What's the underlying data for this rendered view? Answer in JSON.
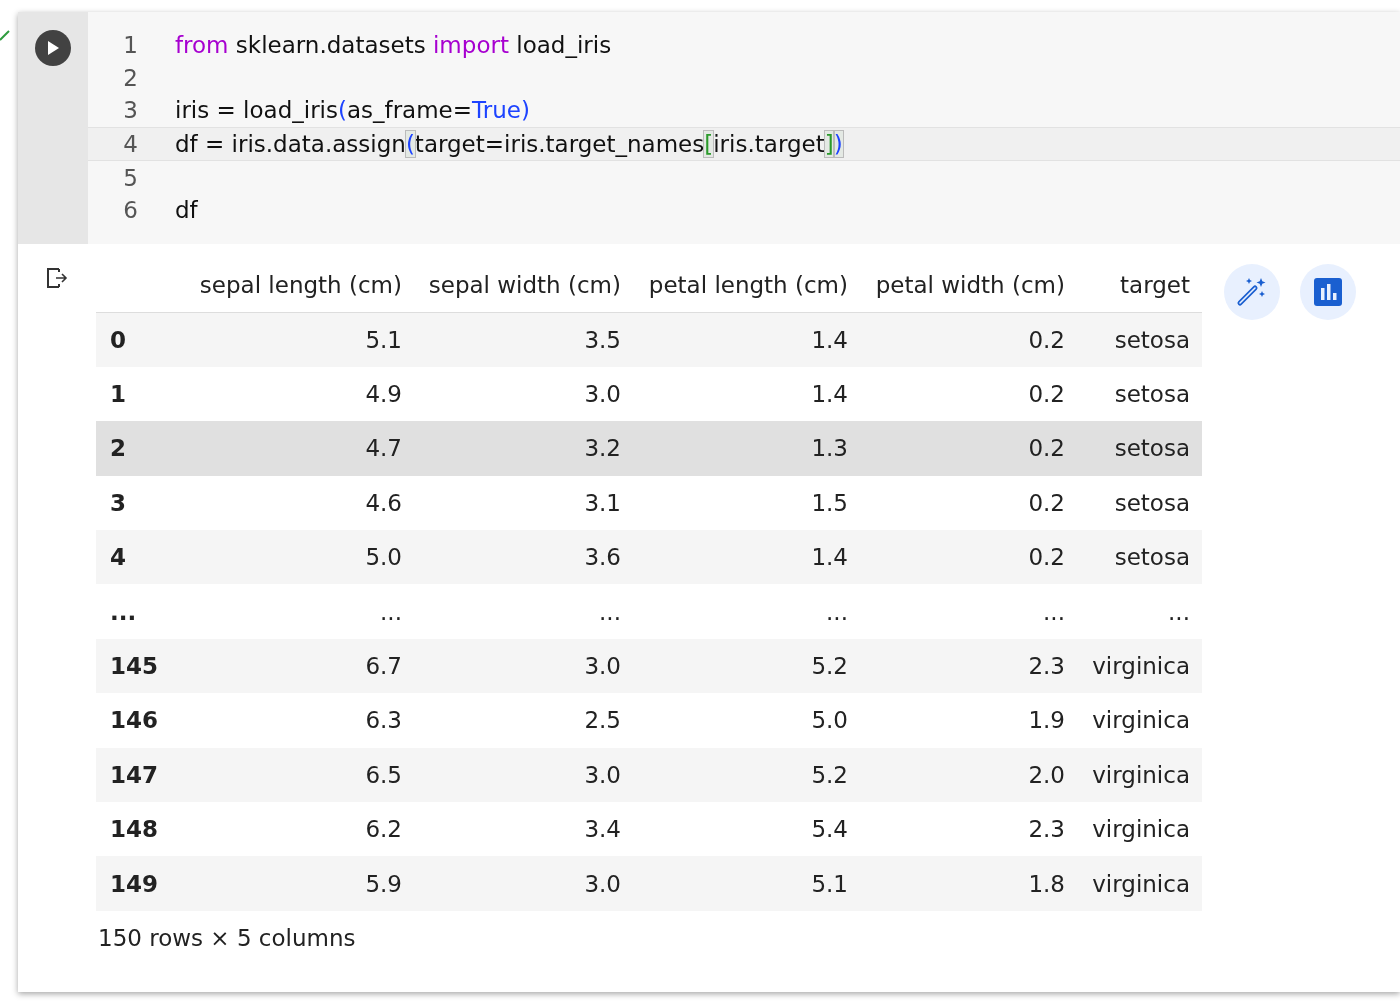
{
  "cell": {
    "succeeded": true,
    "code_lines": [
      {
        "number": "1",
        "current": false,
        "tokens": [
          {
            "kind": "keyword",
            "text": "from"
          },
          {
            "kind": "plain",
            "text": " sklearn.datasets "
          },
          {
            "kind": "keyword",
            "text": "import"
          },
          {
            "kind": "plain",
            "text": " load_iris"
          }
        ]
      },
      {
        "number": "2",
        "current": false
      },
      {
        "number": "3",
        "current": false,
        "tokens": [
          {
            "kind": "plain",
            "text": "iris = load_iris"
          },
          {
            "kind": "paren",
            "text": "("
          },
          {
            "kind": "plain",
            "text": "as_frame="
          },
          {
            "kind": "constant",
            "text": "True"
          },
          {
            "kind": "paren",
            "text": ")"
          }
        ]
      },
      {
        "number": "4",
        "current": true,
        "tokens": [
          {
            "kind": "plain",
            "text": "df = iris.data.assign"
          },
          {
            "kind": "paren-match",
            "text": "("
          },
          {
            "kind": "plain",
            "text": "target=iris.target_names"
          },
          {
            "kind": "bracket",
            "text": "["
          },
          {
            "kind": "plain",
            "text": "iris.target"
          },
          {
            "kind": "bracket",
            "text": "]"
          },
          {
            "kind": "paren-match",
            "text": ")"
          }
        ]
      },
      {
        "number": "5",
        "current": false
      },
      {
        "number": "6",
        "current": false,
        "tokens": [
          {
            "kind": "plain",
            "text": "df"
          }
        ]
      }
    ]
  },
  "table": {
    "columns": [
      "sepal length (cm)",
      "sepal width (cm)",
      "petal length (cm)",
      "petal width (cm)",
      "target"
    ],
    "rows": [
      {
        "index": "0",
        "cells": [
          "5.1",
          "3.5",
          "1.4",
          "0.2",
          "setosa"
        ],
        "highlighted": false
      },
      {
        "index": "1",
        "cells": [
          "4.9",
          "3.0",
          "1.4",
          "0.2",
          "setosa"
        ],
        "highlighted": false
      },
      {
        "index": "2",
        "cells": [
          "4.7",
          "3.2",
          "1.3",
          "0.2",
          "setosa"
        ],
        "highlighted": true
      },
      {
        "index": "3",
        "cells": [
          "4.6",
          "3.1",
          "1.5",
          "0.2",
          "setosa"
        ],
        "highlighted": false
      },
      {
        "index": "4",
        "cells": [
          "5.0",
          "3.6",
          "1.4",
          "0.2",
          "setosa"
        ],
        "highlighted": false
      },
      {
        "index": "...",
        "cells": [
          "...",
          "...",
          "...",
          "...",
          "..."
        ],
        "highlighted": false
      },
      {
        "index": "145",
        "cells": [
          "6.7",
          "3.0",
          "5.2",
          "2.3",
          "virginica"
        ],
        "highlighted": false
      },
      {
        "index": "146",
        "cells": [
          "6.3",
          "2.5",
          "5.0",
          "1.9",
          "virginica"
        ],
        "highlighted": false
      },
      {
        "index": "147",
        "cells": [
          "6.5",
          "3.0",
          "5.2",
          "2.0",
          "virginica"
        ],
        "highlighted": false
      },
      {
        "index": "148",
        "cells": [
          "6.2",
          "3.4",
          "5.4",
          "2.3",
          "virginica"
        ],
        "highlighted": false
      },
      {
        "index": "149",
        "cells": [
          "5.9",
          "3.0",
          "5.1",
          "1.8",
          "virginica"
        ],
        "highlighted": false
      }
    ],
    "shape": "150 rows × 5 columns"
  }
}
